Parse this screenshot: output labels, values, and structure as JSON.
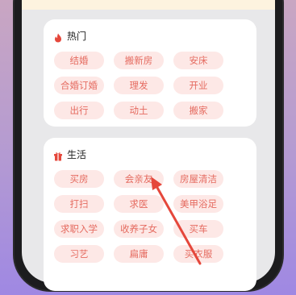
{
  "hot": {
    "title": "热门",
    "icon": "flame-icon",
    "tags": [
      "结婚",
      "搬新房",
      "安床",
      "合婚订婚",
      "理发",
      "开业",
      "出行",
      "动土",
      "搬家"
    ]
  },
  "life": {
    "title": "生活",
    "icon": "gift-icon",
    "tags": [
      "买房",
      "会亲友",
      "房屋清洁",
      "打扫",
      "求医",
      "美甲浴足",
      "求职入学",
      "收养子女",
      "买车",
      "习艺",
      "扁庸",
      "买衣服"
    ]
  },
  "colors": {
    "accent": "#e5473b",
    "tag_bg": "#fde8e6",
    "tag_text": "#e56b60"
  }
}
